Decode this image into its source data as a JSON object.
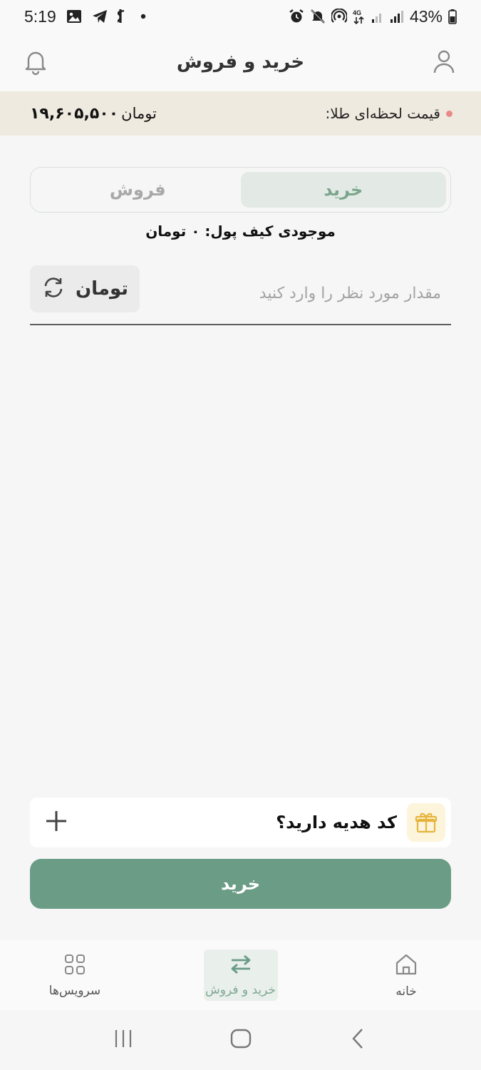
{
  "status_bar": {
    "time": "5:19",
    "battery": "43%",
    "network": "4G"
  },
  "header": {
    "title": "خرید و فروش"
  },
  "price_bar": {
    "label": "قیمت لحظه‌ای طلا:",
    "value": "۱۹,۶۰۵,۵۰۰",
    "unit": "تومان"
  },
  "tabs": {
    "buy": "خرید",
    "sell": "فروش",
    "active": "buy"
  },
  "wallet": {
    "text": "موجودی کیف پول: ۰ تومان"
  },
  "amount_input": {
    "placeholder": "مقدار مورد نظر را وارد کنید",
    "value": "",
    "unit_label": "تومان"
  },
  "gift": {
    "label": "کد هدیه دارید؟"
  },
  "buy_button": {
    "label": "خرید"
  },
  "bottom_nav": {
    "items": [
      {
        "label": "سرویس‌ها",
        "icon": "grid-icon"
      },
      {
        "label": "خرید و فروش",
        "icon": "swap-arrows-icon"
      },
      {
        "label": "خانه",
        "icon": "home-icon"
      }
    ],
    "active": "خرید و فروش"
  },
  "colors": {
    "accent": "#6a9c86",
    "price_bar_bg": "#efeadf",
    "active_tab_bg": "#e3eae5",
    "active_tab_text": "#7ba58d",
    "gift_icon": "#e6b43a",
    "live_dot": "#e88a8a"
  }
}
